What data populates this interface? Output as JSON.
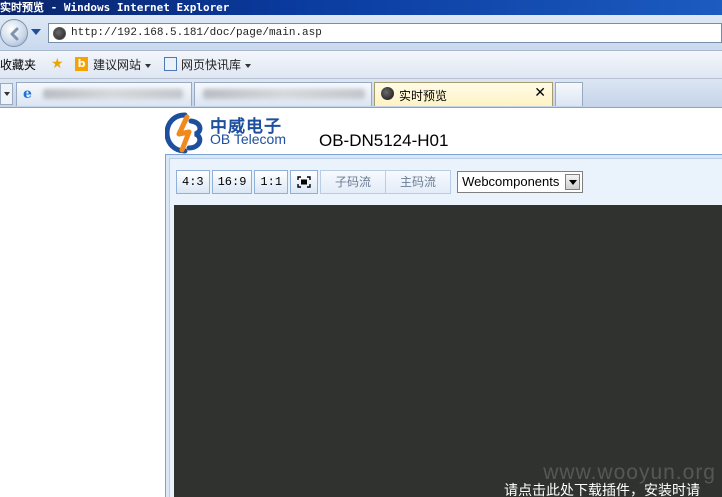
{
  "window": {
    "title": "实时预览 - Windows Internet Explorer"
  },
  "address_bar": {
    "url": "http://192.168.5.181/doc/page/main.asp"
  },
  "favorites_bar": {
    "label": "收藏夹",
    "items": [
      {
        "label": "建议网站",
        "icon": "bing-icon"
      },
      {
        "label": "网页快讯库",
        "icon": "web-slice-icon"
      }
    ]
  },
  "tabs": [
    {
      "label": "",
      "icon": "ie-icon",
      "active": false
    },
    {
      "label": "",
      "icon": "page-icon",
      "active": false
    },
    {
      "label": "实时预览",
      "icon": "camera-icon",
      "active": true,
      "close_label": "✕"
    },
    {
      "label": "",
      "icon": "new-tab",
      "active": false
    }
  ],
  "page": {
    "brand_cn": "中威电子",
    "brand_en": "OB Telecom",
    "model": "OB-DN5124-H01",
    "toolbar": {
      "ratio_buttons": [
        "4:3",
        "16:9",
        "1:1"
      ],
      "fullscreen_icon": "fullscreen-icon",
      "stream_buttons": [
        "子码流",
        "主码流"
      ],
      "player_select": {
        "selected": "Webcomponents"
      }
    },
    "video": {
      "watermark": "www.wooyun.org",
      "plugin_notice": "请点击此处下载插件，安装时请"
    }
  },
  "colors": {
    "title_bar": "#0a246a",
    "brand_blue": "#1d4f9c",
    "video_bg": "#303230",
    "panel_bg": "#eaf2fb"
  }
}
